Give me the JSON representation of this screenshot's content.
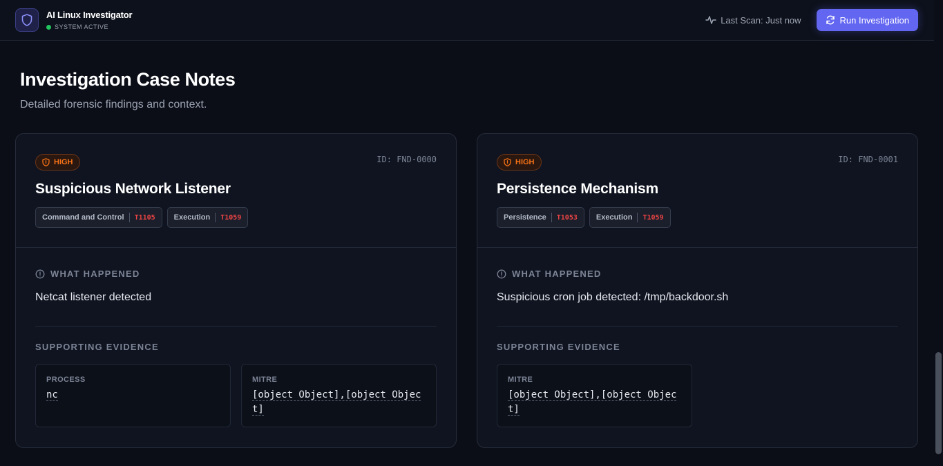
{
  "header": {
    "app_title": "AI Linux Investigator",
    "status": "SYSTEM ACTIVE",
    "last_scan": "Last Scan: Just now",
    "run_button": "Run Investigation"
  },
  "page": {
    "title": "Investigation Case Notes",
    "subtitle": "Detailed forensic findings and context."
  },
  "labels": {
    "what_happened": "WHAT HAPPENED",
    "supporting_evidence": "SUPPORTING EVIDENCE"
  },
  "findings": [
    {
      "severity": "HIGH",
      "id": "ID: FND-0000",
      "title": "Suspicious Network Listener",
      "tags": [
        {
          "name": "Command and Control",
          "technique": "T1105"
        },
        {
          "name": "Execution",
          "technique": "T1059"
        }
      ],
      "what_happened": "Netcat listener detected",
      "evidence": [
        {
          "key": "PROCESS",
          "value": "nc"
        },
        {
          "key": "MITRE",
          "value": "[object Object],[object Object]"
        }
      ]
    },
    {
      "severity": "HIGH",
      "id": "ID: FND-0001",
      "title": "Persistence Mechanism",
      "tags": [
        {
          "name": "Persistence",
          "technique": "T1053"
        },
        {
          "name": "Execution",
          "technique": "T1059"
        }
      ],
      "what_happened": "Suspicious cron job detected: /tmp/backdoor.sh",
      "evidence": [
        {
          "key": "MITRE",
          "value": "[object Object],[object Object]"
        }
      ]
    }
  ],
  "colors": {
    "accent": "#6366f1",
    "severity_high": "#f97316",
    "technique": "#ef4444",
    "status_ok": "#22c55e"
  }
}
